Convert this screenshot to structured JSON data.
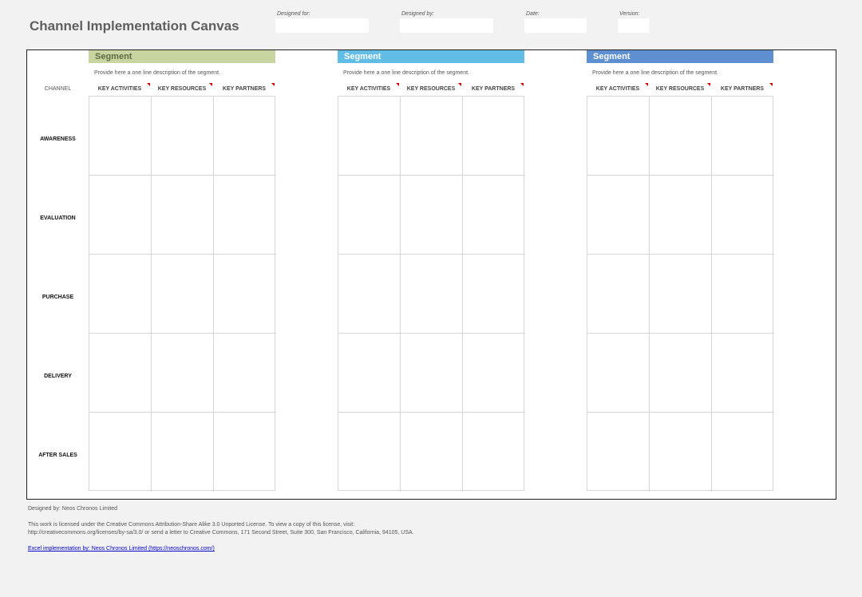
{
  "title": "Channel Implementation Canvas",
  "meta": {
    "designed_for": "Designed for:",
    "designed_by": "Designed by:",
    "date": "Date:",
    "version": "Version:"
  },
  "channel_label": "CHANNEL",
  "rows": [
    "AWARENESS",
    "EVALUATION",
    "PURCHASE",
    "DELIVERY",
    "AFTER SALES"
  ],
  "columns": [
    "KEY ACTIVITIES",
    "KEY RESOURCES",
    "KEY PARTNERS"
  ],
  "segments": [
    {
      "title": "Segment",
      "description": "Provide here a one line description of the segment.",
      "color": "#c8d5a0",
      "text_color": "#5f6b45"
    },
    {
      "title": "Segment",
      "description": "Provide here a one line description of the segment.",
      "color": "#62bde6",
      "text_color": "#ffffff"
    },
    {
      "title": "Segment",
      "description": "Provide here a one line description of the segment.",
      "color": "#5e8fd0",
      "text_color": "#ffffff"
    }
  ],
  "footer": {
    "designed_by": "Designed by: Neos Chronos Limited",
    "license_line1": "This work is licensed under the Creative Commons Attribution-Share Alike 3.0 Unported License. To view a copy of this license, visit:",
    "license_line2": "http://creativecommons.org/licenses/by-sa/3.0/ or send a letter to Creative Commons, 171 Second Street, Suite 300, San Francisco, California, 94105, USA.",
    "link": "Excel implementation by: Neos Chronos Limited (https://neoschronos.com/)"
  }
}
